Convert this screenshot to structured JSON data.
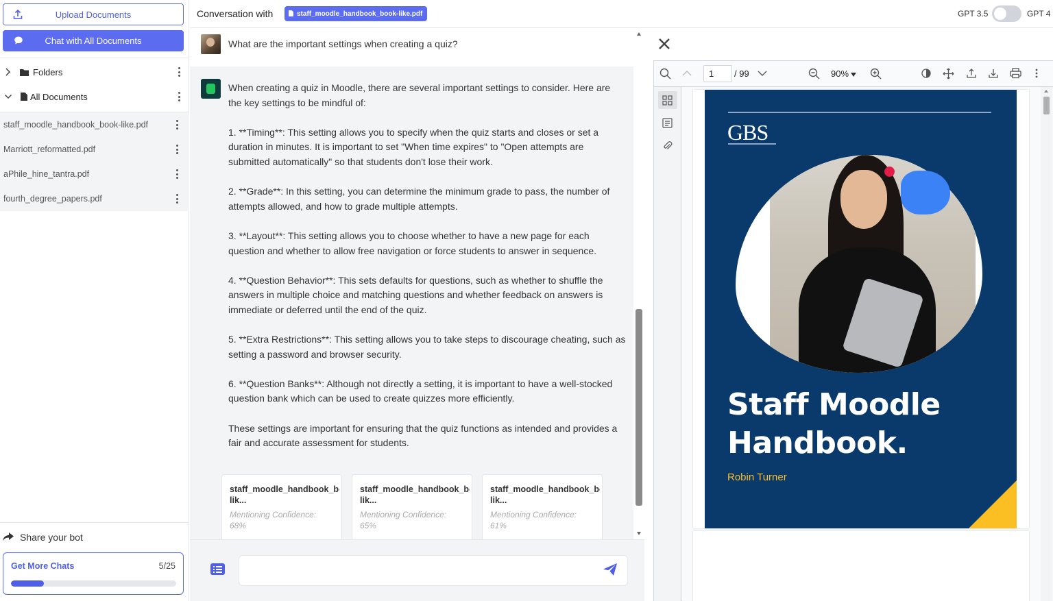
{
  "sidebar": {
    "upload_label": "Upload Documents",
    "chat_all_label": "Chat with All Documents",
    "folders_label": "Folders",
    "all_documents_label": "All Documents",
    "documents": [
      {
        "name": "staff_moodle_handbook_book-like.pdf"
      },
      {
        "name": "Marriott_reformatted.pdf"
      },
      {
        "name": "aPhile_hine_tantra.pdf"
      },
      {
        "name": "fourth_degree_papers.pdf"
      }
    ],
    "share_label": "Share your bot",
    "get_more": {
      "label": "Get More Chats",
      "count": "5/25",
      "progress_fraction": 0.2
    }
  },
  "header": {
    "conversation_label": "Conversation with",
    "file_chip": "staff_moodle_handbook_book-like.pdf",
    "model_left": "GPT 3.5",
    "model_right": "GPT 4",
    "gpt4_enabled": false
  },
  "chat": {
    "question": "What are the important settings when creating a quiz?",
    "answer_paragraphs": [
      "When creating a quiz in Moodle, there are several important settings to consider. Here are the key settings to be mindful of:",
      "1. **Timing**: This setting allows you to specify when the quiz starts and closes or set a duration in minutes. It is important to set \"When time expires\" to \"Open attempts are submitted automatically\" so that students don't lose their work.",
      "2. **Grade**: In this setting, you can determine the minimum grade to pass, the number of attempts allowed, and how to grade multiple attempts.",
      "3. **Layout**: This setting allows you to choose whether to have a new page for each question and whether to allow free navigation or force students to answer in sequence.",
      "4. **Question Behavior**: This sets defaults for questions, such as whether to shuffle the answers in multiple choice and matching questions and whether feedback on answers is immediate or deferred until the end of the quiz.",
      "5. **Extra Restrictions**: This setting allows you to take steps to discourage cheating, such as setting a password and browser security.",
      "6. **Question Banks**: Although not directly a setting, it is important to have a well-stocked question bank which can be used to create quizzes more efficiently.",
      "These settings are important for ensuring that the quiz functions as intended and provides a fair and accurate assessment for students."
    ],
    "sources": [
      {
        "title": "staff_moodle_handbook_book-",
        "title2": "lik...",
        "confidence_label": "Mentioning Confidence:",
        "confidence": "68%"
      },
      {
        "title": "staff_moodle_handbook_book-",
        "title2": "lik...",
        "confidence_label": "Mentioning Confidence:",
        "confidence": "65%"
      },
      {
        "title": "staff_moodle_handbook_book-",
        "title2": "lik...",
        "confidence_label": "Mentioning Confidence:",
        "confidence": "61%"
      }
    ],
    "input_placeholder": ""
  },
  "pdf": {
    "page_current": "1",
    "page_total": "/ 99",
    "zoom": "90%",
    "cover": {
      "brand": "GBS",
      "title_line1": "Staff Moodle",
      "title_line2": "Handbook.",
      "author": "Robin Turner"
    }
  },
  "colors": {
    "accent": "#5b6cf0",
    "cover_bg": "#0a3a6b",
    "cover_accent": "#fbbf24"
  }
}
